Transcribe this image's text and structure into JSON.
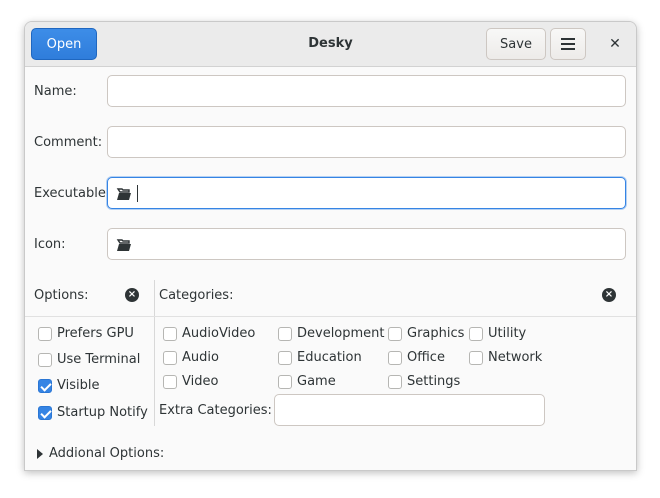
{
  "header": {
    "open_label": "Open",
    "title": "Desky",
    "save_label": "Save",
    "menu_icon": "hamburger-icon",
    "close_glyph": "✕"
  },
  "form": {
    "name_label": "Name:",
    "name_value": "",
    "comment_label": "Comment:",
    "comment_value": "",
    "executable_label": "Executable:",
    "executable_value": "",
    "icon_label": "Icon:",
    "icon_value": "",
    "file_icon": "document-open-icon"
  },
  "options": {
    "label": "Options:",
    "clear_glyph": "×",
    "items": [
      {
        "label": "Prefers GPU",
        "checked": false
      },
      {
        "label": "Use Terminal",
        "checked": false
      },
      {
        "label": "Visible",
        "checked": true
      },
      {
        "label": "Startup Notify",
        "checked": true
      }
    ]
  },
  "categories": {
    "label": "Categories:",
    "clear_glyph": "×",
    "items": [
      {
        "label": "AudioVideo",
        "checked": false
      },
      {
        "label": "Development",
        "checked": false
      },
      {
        "label": "Graphics",
        "checked": false
      },
      {
        "label": "Utility",
        "checked": false
      },
      {
        "label": "Audio",
        "checked": false
      },
      {
        "label": "Education",
        "checked": false
      },
      {
        "label": "Office",
        "checked": false
      },
      {
        "label": "Network",
        "checked": false
      },
      {
        "label": "Video",
        "checked": false
      },
      {
        "label": "Game",
        "checked": false
      },
      {
        "label": "Settings",
        "checked": false
      }
    ],
    "extra_label": "Extra Categories:",
    "extra_value": ""
  },
  "expander": {
    "label": "Addional Options:"
  },
  "colors": {
    "accent": "#3584e4",
    "open_button": "#2f7ddb"
  }
}
